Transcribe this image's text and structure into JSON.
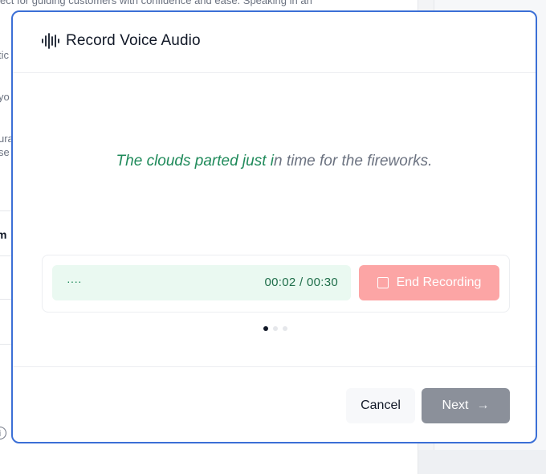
{
  "background": {
    "lines": [
      "ect for guiding customers with confidence and ease. Speaking in an",
      "tic",
      "yo",
      "ura",
      "se",
      "m"
    ],
    "info_icon": "info-icon"
  },
  "modal": {
    "title": "Record Voice Audio",
    "icon": "audio-waveform-icon",
    "accent_color": "#3b6fd6"
  },
  "prompt": {
    "spoken": "The clouds parted just i",
    "remaining": "n time for the fireworks.",
    "spoken_color": "#1f8a5a",
    "remaining_color": "#6b7280"
  },
  "recorder": {
    "level_dots": "····",
    "elapsed": "00:02",
    "limit": "00:30",
    "time_display": "00:02 / 00:30",
    "end_label": "End Recording",
    "end_color": "#fca5a5"
  },
  "pager": {
    "total": 3,
    "active": 0
  },
  "footer": {
    "cancel_label": "Cancel",
    "next_label": "Next",
    "next_icon": "arrow-right-icon"
  }
}
